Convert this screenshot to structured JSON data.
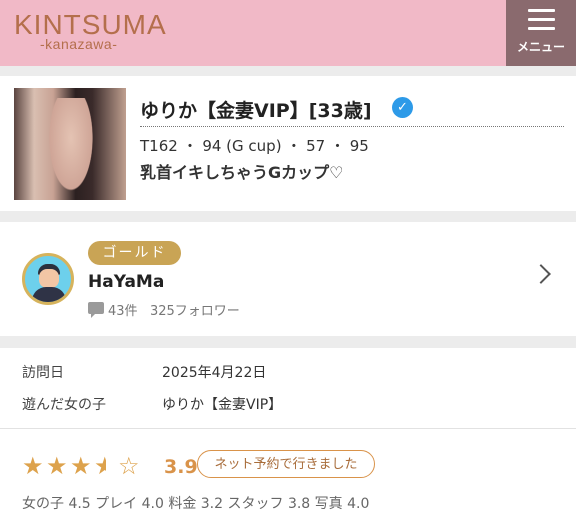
{
  "header": {
    "logo_main": "KINTSUMA",
    "logo_sub": "-kanazawa-",
    "menu_label": "メニュー",
    "menu_icon": "hamburger-icon",
    "bg_color": "#f1b9c7",
    "logo_color": "#b46f4c"
  },
  "profile": {
    "name": "ゆりか【金妻VIP】[33歳]",
    "verified_icon": "verified-check-icon",
    "verified_mark": "✓",
    "stats": "T162 ・ 94 (G cup) ・ 57 ・ 95",
    "catchphrase": "乳首イキしちゃうGカップ♡"
  },
  "reviewer": {
    "rank_badge": "ゴールド",
    "name": "HaYaMa",
    "reviews": "43件",
    "followers": "325フォロワー",
    "badge_color": "#c9a455"
  },
  "review": {
    "visit_label": "訪問日",
    "visit_date": "2025年4月22日",
    "girl_label": "遊んだ女の子",
    "girl_name": "ゆりか【金妻VIP】",
    "stars": 3.5,
    "score": "3.9",
    "booking_badge": "ネット予約で行きました",
    "sub_scores": "女の子 4.5 プレイ 4.0 料金 3.2 スタッフ 3.8 写真 4.0",
    "accent_color": "#dda24c"
  }
}
